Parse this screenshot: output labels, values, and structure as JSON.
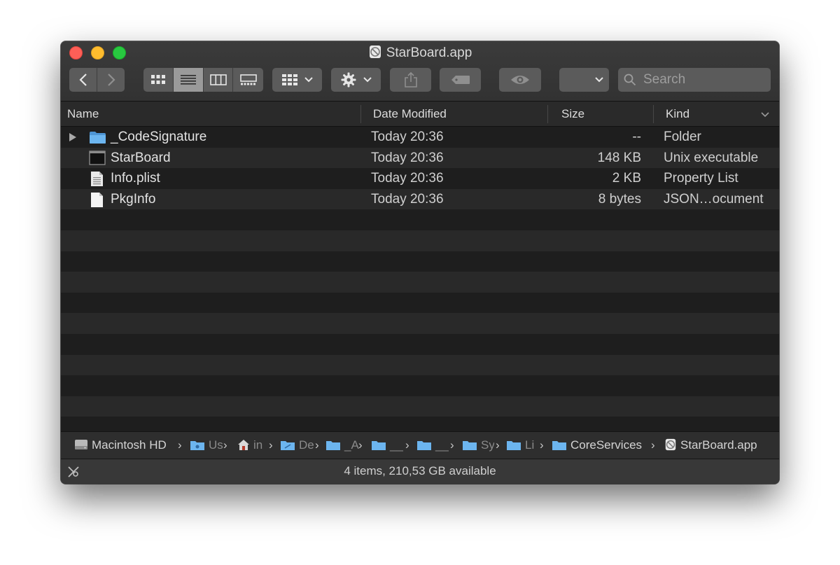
{
  "window": {
    "title": "StarBoard.app"
  },
  "toolbar": {
    "search_placeholder": "Search"
  },
  "columns": {
    "name": "Name",
    "date": "Date Modified",
    "size": "Size",
    "kind": "Kind"
  },
  "files": [
    {
      "name": "_CodeSignature",
      "date": "Today 20:36",
      "size": "--",
      "kind": "Folder",
      "icon": "folder-icon"
    },
    {
      "name": "StarBoard",
      "date": "Today 20:36",
      "size": "148 KB",
      "kind": "Unix executable",
      "icon": "executable-icon"
    },
    {
      "name": "Info.plist",
      "date": "Today 20:36",
      "size": "2 KB",
      "kind": "Property List",
      "icon": "plist-file-icon"
    },
    {
      "name": "PkgInfo",
      "date": "Today 20:36",
      "size": "8 bytes",
      "kind": "JSON…ocument",
      "icon": "document-icon"
    }
  ],
  "pathbar": {
    "items": [
      "Macintosh HD",
      "Us",
      "in",
      "De",
      "_A",
      "__",
      "__",
      "Sy",
      "Li",
      "CoreServices",
      "StarBoard.app"
    ]
  },
  "status": {
    "text": "4 items, 210,53 GB available"
  },
  "colors": {
    "folder": "#5fa8e6",
    "close": "#fe5f57",
    "minimize": "#febc2e",
    "zoom": "#28c840"
  }
}
